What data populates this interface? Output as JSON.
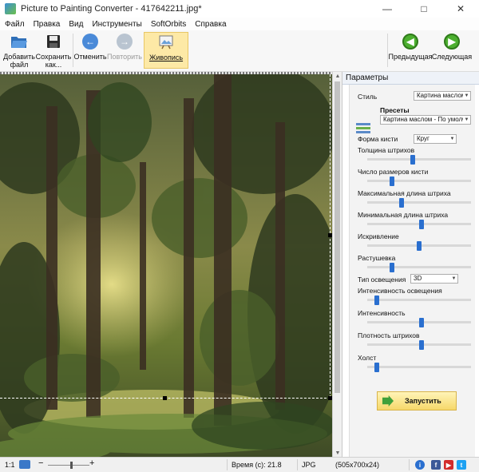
{
  "window": {
    "title": "Picture to Painting Converter - 417642211.jpg*",
    "minimize_icon": "minimize-icon",
    "maximize_icon": "maximize-icon",
    "close_icon": "close-icon"
  },
  "menu": [
    "Файл",
    "Правка",
    "Вид",
    "Инструменты",
    "SoftOrbits",
    "Справка"
  ],
  "toolbar": {
    "add_file": "Добавить\nфайл",
    "save_as": "Сохранить\nкак...",
    "undo": "Отменить",
    "redo": "Повторить",
    "painting": "Живопись",
    "prev": "Предыдущая",
    "next": "Следующая"
  },
  "panel": {
    "header": "Параметры",
    "style_label": "Стиль",
    "style_value": "Картина маслом",
    "presets_label": "Пресеты",
    "presets_value": "Картина маслом - По умолча",
    "brush_shape_label": "Форма кисти",
    "brush_shape_value": "Круг",
    "light_type_label": "Тип освещения",
    "light_type_value": "3D",
    "sliders": [
      {
        "label": "Толщина штрихов",
        "value": 0.44
      },
      {
        "label": "Число размеров кисти",
        "value": 0.24
      },
      {
        "label": "Максимальная длина штриха",
        "value": 0.33
      },
      {
        "label": "Минимальная длина штриха",
        "value": 0.52
      },
      {
        "label": "Искривление",
        "value": 0.5
      },
      {
        "label": "Растушевка",
        "value": 0.24
      },
      {
        "label": "Интенсивность освещения",
        "value": 0.09
      },
      {
        "label": "Интенсивность",
        "value": 0.52
      },
      {
        "label": "Плотность штрихов",
        "value": 0.52
      },
      {
        "label": "Холст",
        "value": 0.09
      }
    ],
    "run_label": "Запустить"
  },
  "status": {
    "ratio": "1:1",
    "time": "Время (с): 21.8",
    "format": "JPG",
    "dimensions": "(505x700x24)"
  },
  "colors": {
    "accent": "#2a6fcf",
    "run_button": "#f6d86a",
    "nav_green": "#4caf2f"
  }
}
